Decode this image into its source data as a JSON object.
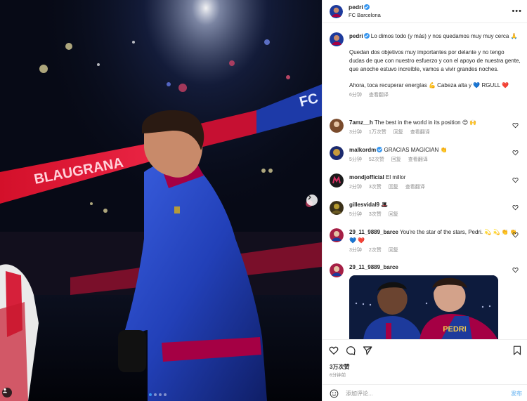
{
  "post": {
    "author": "pedri",
    "location": "FC Barcelona",
    "caption_author": "pedri",
    "caption_line1": "Lo dimos todo (y más) y nos quedamos muy muy cerca 🙏",
    "caption_line2": "Quedan dos objetivos muy importantes por delante y no tengo dudas de que con nuestro esfuerzo y con el apoyo de nuestra gente, que anoche estuvo increíble, vamos a vivir grandes noches.",
    "caption_line3": "Ahora, toca recuperar energías 💪 Cabeza alta y 💙 RGULL ❤️",
    "caption_time": "6分钟",
    "caption_translate": "查看翻译"
  },
  "media": {
    "banner_left": "BLAUGRANA",
    "banner_right": "FC",
    "jersey_name": "PEDRI"
  },
  "comments": [
    {
      "user": "7amz__h",
      "verified": false,
      "text": "The best in the world in its position 😍 🙌",
      "time": "3分钟",
      "likes": "1万次赞",
      "reply": "回复",
      "translate": "查看翻译",
      "avatar_color": "#7a4b2c"
    },
    {
      "user": "malkordm",
      "verified": true,
      "text": "GRACIAS MAGICIAN 👏",
      "time": "5分钟",
      "likes": "52次赞",
      "reply": "回复",
      "translate": "查看翻译",
      "avatar_color": "#c79a3b"
    },
    {
      "user": "mondjofficial",
      "verified": false,
      "text": "El millor",
      "time": "2分钟",
      "likes": "3次赞",
      "reply": "回复",
      "translate": "查看翻译",
      "avatar_color": "#d62f63"
    },
    {
      "user": "gillesvidal9",
      "verified": false,
      "text": "🎩",
      "time": "5分钟",
      "likes": "3次赞",
      "reply": "回复",
      "translate": "",
      "avatar_color": "#b59a2e"
    },
    {
      "user": "29_11_9889_barce",
      "verified": false,
      "text": "You're the star of the stars, Pedri. 💫 💫 👏 👏 💙 ❤️",
      "time": "3分钟",
      "likes": "2次赞",
      "reply": "回复",
      "translate": "",
      "avatar_color": "#a51f45"
    },
    {
      "user": "29_11_9889_barce",
      "verified": false,
      "text": "",
      "time": "",
      "likes": "",
      "reply": "",
      "translate": "",
      "avatar_color": "#a51f45"
    }
  ],
  "actions": {
    "likes": "3万次赞",
    "time": "6分钟前",
    "comment_placeholder": "添加评论...",
    "post_label": "发布"
  },
  "colors": {
    "accent": "#3897f0",
    "barca_blue": "#1d3a9c",
    "barca_red": "#a50044",
    "heart_red": "#ed4956"
  }
}
